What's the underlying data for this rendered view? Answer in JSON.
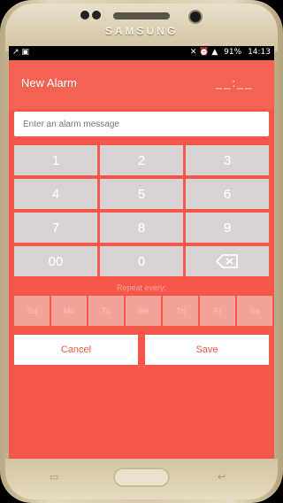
{
  "device": {
    "brand": "SAMSUNG"
  },
  "status_bar": {
    "left": "↗  ▣",
    "battery": "91%",
    "time": "14:13",
    "icons": "✕ ⏰ ▲"
  },
  "header": {
    "title": "New Alarm",
    "time_display": "__:__"
  },
  "message": {
    "placeholder": "Enter an alarm message",
    "value": ""
  },
  "keypad": {
    "keys": [
      "1",
      "2",
      "3",
      "4",
      "5",
      "6",
      "7",
      "8",
      "9",
      "00",
      "0"
    ],
    "backspace_icon": "backspace-icon"
  },
  "repeat": {
    "label": "Repeat every:",
    "days": [
      "Su",
      "Mo",
      "Tu",
      "We",
      "Th",
      "Fr",
      "Sa"
    ]
  },
  "actions": {
    "cancel": "Cancel",
    "save": "Save"
  },
  "colors": {
    "accent": "#f5584a",
    "key": "#d8d3d2",
    "day": "#f3a39a"
  }
}
